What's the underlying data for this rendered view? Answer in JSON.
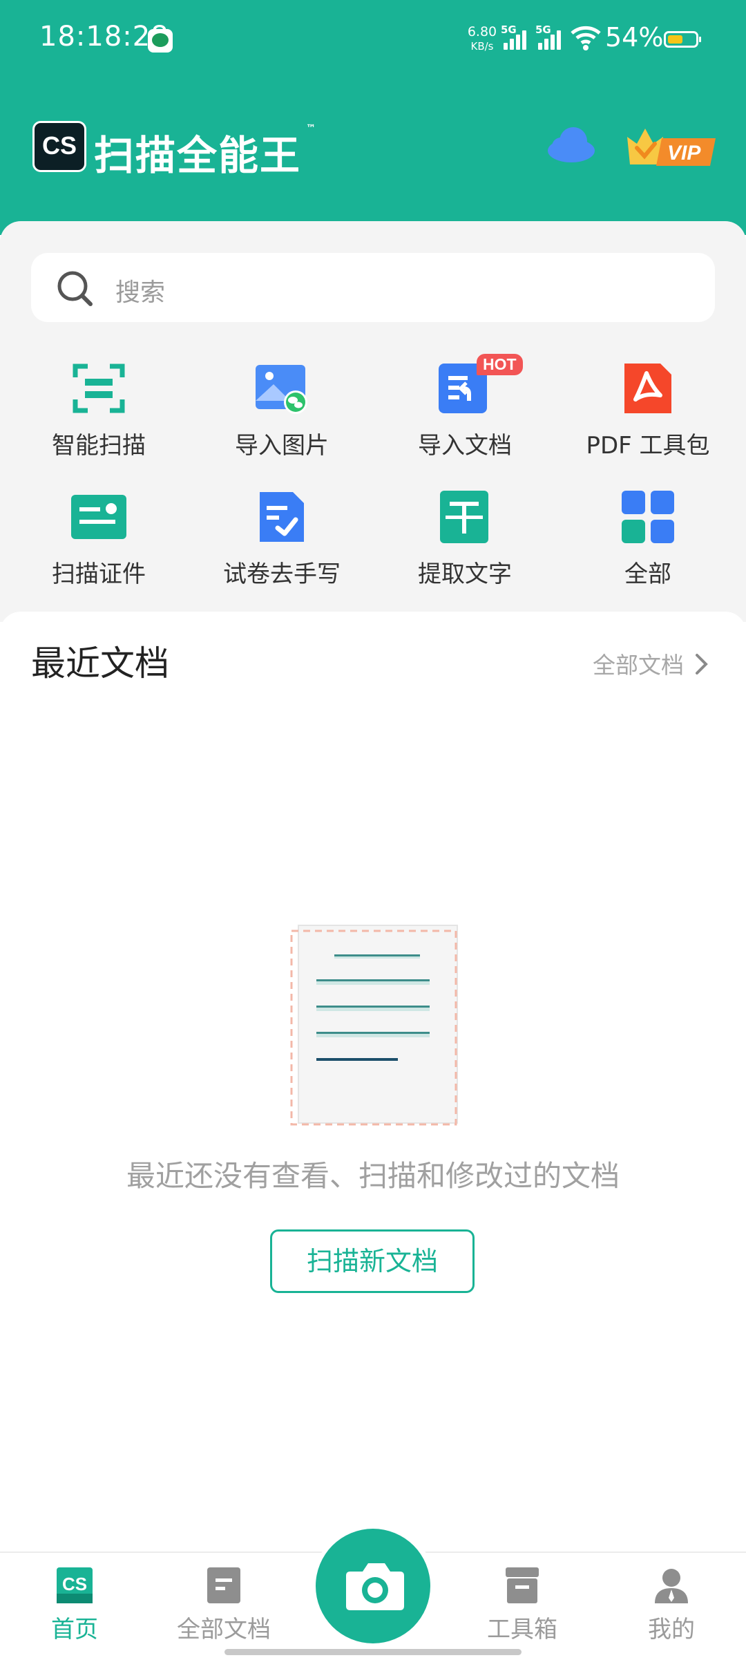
{
  "status_bar": {
    "time": "18:18:28",
    "speed_value": "6.80",
    "speed_unit": "KB/s",
    "signal1_label": "5G",
    "signal2_label": "5G",
    "battery_percent": "54%",
    "battery_level": 0.54
  },
  "header": {
    "logo_mark": "CS",
    "app_name": "扫描全能王",
    "trademark": "™",
    "cloud_icon": "cloud-icon",
    "vip_label": "VIP"
  },
  "search": {
    "placeholder": "搜索"
  },
  "tools": [
    {
      "label": "智能扫描",
      "icon": "smart-scan-icon"
    },
    {
      "label": "导入图片",
      "icon": "import-image-icon"
    },
    {
      "label": "导入文档",
      "icon": "import-document-icon",
      "badge": "HOT"
    },
    {
      "label": "PDF 工具包",
      "icon": "pdf-toolkit-icon"
    },
    {
      "label": "扫描证件",
      "icon": "scan-id-icon"
    },
    {
      "label": "试卷去手写",
      "icon": "remove-handwriting-icon"
    },
    {
      "label": "提取文字",
      "icon": "extract-text-icon"
    },
    {
      "label": "全部",
      "icon": "all-tools-icon"
    }
  ],
  "recent": {
    "title": "最近文档",
    "all_docs_link": "全部文档",
    "empty_message": "最近还没有查看、扫描和修改过的文档",
    "scan_new_button": "扫描新文档"
  },
  "bottom_nav": [
    {
      "label": "首页",
      "icon": "home-icon",
      "active": true
    },
    {
      "label": "全部文档",
      "icon": "all-documents-icon",
      "active": false
    },
    {
      "label": "",
      "icon": "camera-icon",
      "active": false
    },
    {
      "label": "工具箱",
      "icon": "toolbox-icon",
      "active": false
    },
    {
      "label": "我的",
      "icon": "profile-icon",
      "active": false
    }
  ],
  "colors": {
    "brand": "#19b395",
    "hot_badge": "#f25555",
    "muted_text": "#a0a0a0"
  }
}
